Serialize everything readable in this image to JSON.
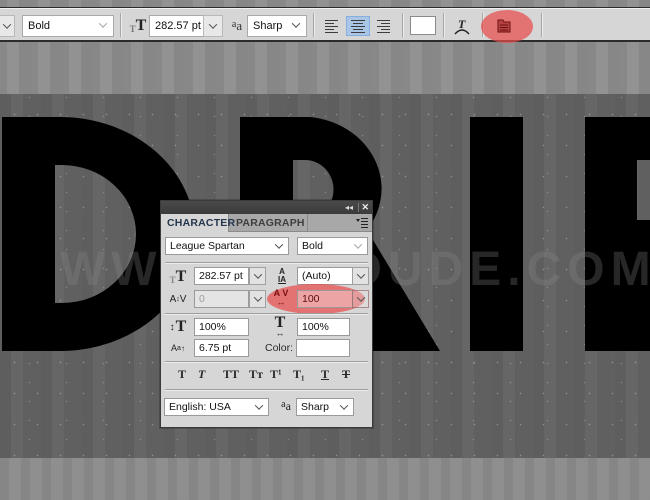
{
  "canvas": {
    "headline_text": "DRIP",
    "watermark": "WWW.PSDDUDE.COM",
    "colors": {
      "text_fill": "#000000",
      "background_mid": "#636363",
      "background_outer": "#8e8e8e"
    }
  },
  "options_bar": {
    "font_family_dropdown": "",
    "font_style": "Bold",
    "font_size": "282.57 pt",
    "anti_alias": "Sharp",
    "alignment": [
      "left",
      "center",
      "right"
    ],
    "alignment_selected": "center",
    "text_color": "#ffffff",
    "icons": {
      "font_size": "font-size-icon",
      "anti_alias": "anti-alias-icon",
      "warp_text": "warp-text-icon",
      "toggle_panels": "character-paragraph-panel-icon"
    },
    "highlight_color": "#e84c4c"
  },
  "character_panel": {
    "tabs": [
      {
        "label": "CHARACTER",
        "active": true
      },
      {
        "label": "PARAGRAPH",
        "active": false
      }
    ],
    "font_family": "League Spartan",
    "font_style": "Bold",
    "font_size": "282.57 pt",
    "leading": "(Auto)",
    "kerning": "0",
    "tracking": "100",
    "vertical_scale": "100%",
    "horizontal_scale": "100%",
    "baseline_shift": "6.75 pt",
    "color_label": "Color:",
    "color_value": "#ffffff",
    "style_buttons": [
      {
        "name": "faux-bold",
        "glyph": "T"
      },
      {
        "name": "faux-italic",
        "glyph": "T"
      },
      {
        "name": "all-caps",
        "glyph": "TT"
      },
      {
        "name": "small-caps",
        "glyph": "Tт"
      },
      {
        "name": "superscript",
        "glyph": "T¹"
      },
      {
        "name": "subscript",
        "glyph": "T₁"
      },
      {
        "name": "underline",
        "glyph": "T"
      },
      {
        "name": "strikethrough",
        "glyph": "T"
      }
    ],
    "language": "English: USA",
    "anti_alias": "Sharp",
    "anti_alias_glyph": "aa",
    "titlebar": {
      "collapse": "◂◂",
      "close": "✕"
    },
    "menu_icon": "panel-menu-icon"
  }
}
